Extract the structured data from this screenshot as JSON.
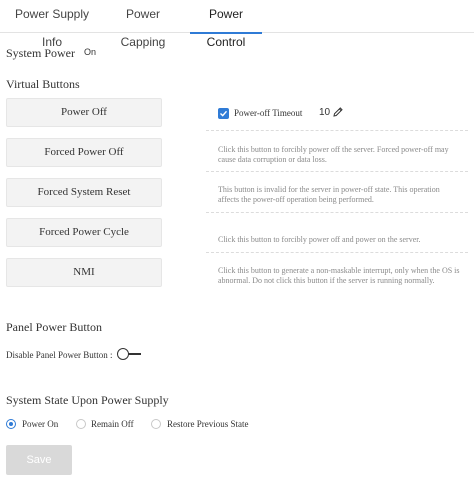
{
  "tabs": [
    {
      "label": "Power Supply Info"
    },
    {
      "label": "Power Capping"
    },
    {
      "label": "Power Control"
    }
  ],
  "system_power": {
    "label": "System Power",
    "value": "On"
  },
  "virtual_buttons": {
    "title": "Virtual Buttons",
    "buttons": [
      {
        "label": "Power Off"
      },
      {
        "label": "Forced Power Off"
      },
      {
        "label": "Forced System Reset"
      },
      {
        "label": "Forced Power Cycle"
      },
      {
        "label": "NMI"
      }
    ],
    "timeout": {
      "label": "Power-off Timeout",
      "value": "10",
      "checked": true
    },
    "descriptions": [
      "Click this button to forcibly power off the server. Forced power-off may cause data corruption or data loss.",
      "This button is invalid for the server in power-off state. This operation affects the power-off operation being performed.",
      "Click this button to forcibly power off and power on the server.",
      "Click this button to generate a non-maskable interrupt, only when the OS is abnormal. Do not click this button if the server is running normally."
    ]
  },
  "panel_power_button": {
    "title": "Panel Power Button",
    "disable_label": "Disable Panel Power Button :",
    "enabled": false
  },
  "system_state": {
    "title": "System State Upon Power Supply",
    "options": [
      {
        "label": "Power On",
        "checked": true
      },
      {
        "label": "Remain Off",
        "checked": false
      },
      {
        "label": "Restore Previous State",
        "checked": false
      }
    ]
  },
  "save_label": "Save",
  "colors": {
    "accent": "#2f7bd6",
    "button_bg": "#f3f3f3",
    "save_disabled": "#d9d9d9"
  }
}
